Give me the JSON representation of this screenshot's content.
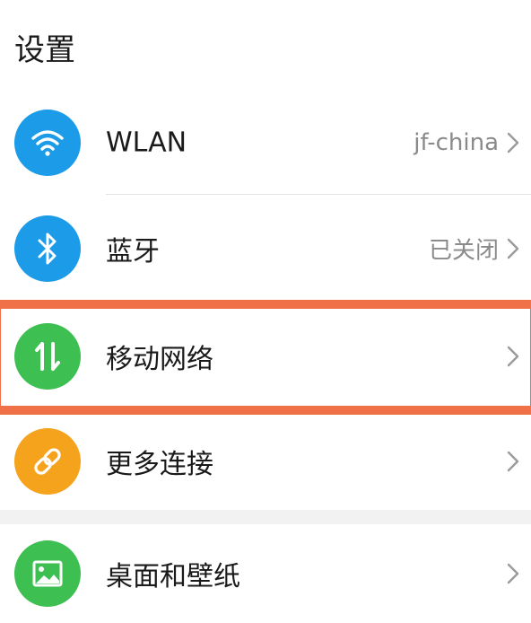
{
  "page": {
    "title": "设置"
  },
  "items": [
    {
      "label": "WLAN",
      "value": "jf-china",
      "icon": "wifi-icon",
      "icon_color": "#1b9be8"
    },
    {
      "label": "蓝牙",
      "value": "已关闭",
      "icon": "bluetooth-icon",
      "icon_color": "#1b9be8"
    },
    {
      "label": "移动网络",
      "value": "",
      "icon": "mobile-data-icon",
      "icon_color": "#3dbf52",
      "highlighted": true
    },
    {
      "label": "更多连接",
      "value": "",
      "icon": "link-icon",
      "icon_color": "#f5a21c"
    },
    {
      "label": "桌面和壁纸",
      "value": "",
      "icon": "wallpaper-icon",
      "icon_color": "#3dbf52"
    }
  ],
  "colors": {
    "highlight": "#f07048",
    "section_gap": "#f2f2f2",
    "divider": "#e2e2e2",
    "chevron": "#9a9a9a"
  }
}
